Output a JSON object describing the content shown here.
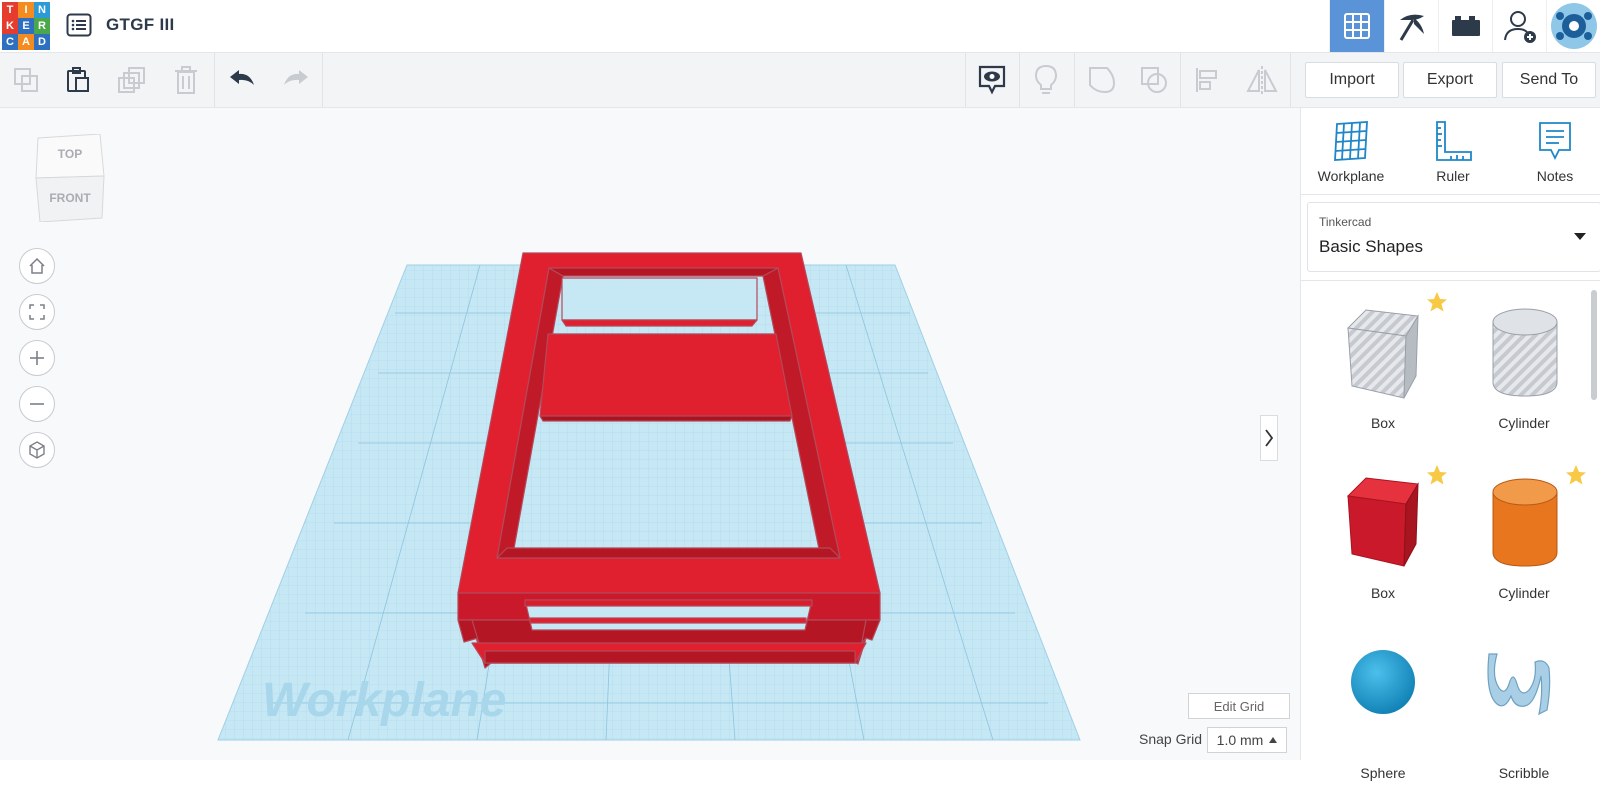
{
  "app": {
    "title": "GTGF III",
    "logo_letters": [
      "T",
      "I",
      "N",
      "K",
      "E",
      "R",
      "C",
      "A",
      "D"
    ],
    "logo_colors": [
      "#e63c2e",
      "#f48b20",
      "#2b9ad6",
      "#e63c2e",
      "#2f6fbf",
      "#4aa74a",
      "#2f6fbf",
      "#f48b20",
      "#2f6fbf"
    ]
  },
  "top_icons": [
    {
      "name": "3d-design-view-icon",
      "active": true
    },
    {
      "name": "circuits-pickaxe-icon",
      "active": false
    },
    {
      "name": "bricks-view-icon",
      "active": false
    },
    {
      "name": "invite-user-icon",
      "active": false
    },
    {
      "name": "user-avatar-icon",
      "active": false
    }
  ],
  "toolbar": {
    "import_label": "Import",
    "export_label": "Export",
    "send_to_label": "Send To"
  },
  "viewcube": {
    "top_label": "TOP",
    "front_label": "FRONT"
  },
  "workplane": {
    "watermark": "Workplane",
    "edit_grid_label": "Edit Grid",
    "snap_grid_label": "Snap Grid",
    "snap_grid_value": "1.0 mm"
  },
  "panel": {
    "tools": [
      {
        "label": "Workplane",
        "icon": "workplane-grid-icon"
      },
      {
        "label": "Ruler",
        "icon": "ruler-icon"
      },
      {
        "label": "Notes",
        "icon": "notes-icon"
      }
    ],
    "library_category": "Tinkercad",
    "library_name": "Basic Shapes",
    "shapes": [
      {
        "label": "Box",
        "icon": "hole-box-icon",
        "starred": true
      },
      {
        "label": "Cylinder",
        "icon": "hole-cylinder-icon",
        "starred": false
      },
      {
        "label": "Box",
        "icon": "red-box-icon",
        "starred": true
      },
      {
        "label": "Cylinder",
        "icon": "orange-cylinder-icon",
        "starred": true
      },
      {
        "label": "Sphere",
        "icon": "blue-sphere-icon",
        "starred": false
      },
      {
        "label": "Scribble",
        "icon": "scribble-icon",
        "starred": false
      }
    ]
  },
  "colors": {
    "accent": "#5b93d9",
    "model_red": "#e01f2f",
    "workplane_blue": "#bfe3f1",
    "orange": "#e8761e",
    "sphere_blue": "#1f9bd1"
  }
}
